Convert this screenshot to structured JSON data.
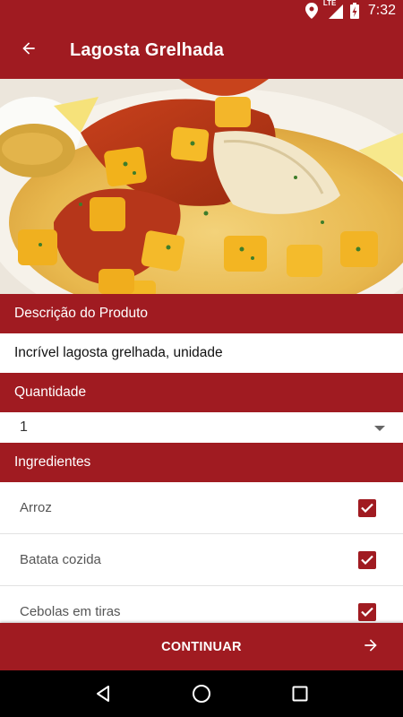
{
  "status_bar": {
    "network": "LTE",
    "time": "7:32",
    "icons": [
      "location-icon",
      "signal-icon",
      "battery-icon"
    ]
  },
  "app_bar": {
    "title": "Lagosta Grelhada",
    "back_icon": "arrow-back-icon"
  },
  "product": {
    "image_icon": "food-photo-icon",
    "description_header": "Descrição do Produto",
    "description": "Incrível lagosta grelhada, unidade"
  },
  "quantity": {
    "header": "Quantidade",
    "selected": "1"
  },
  "ingredients": {
    "header": "Ingredientes",
    "items": [
      {
        "label": "Arroz",
        "checked": true
      },
      {
        "label": "Batata cozida",
        "checked": true
      },
      {
        "label": "Cebolas em tiras",
        "checked": true
      }
    ]
  },
  "footer": {
    "continue_label": "CONTINUAR",
    "continue_icon": "arrow-forward-icon"
  },
  "colors": {
    "primary": "#a01b21",
    "background": "#ffffff",
    "nav_bar": "#000000"
  }
}
